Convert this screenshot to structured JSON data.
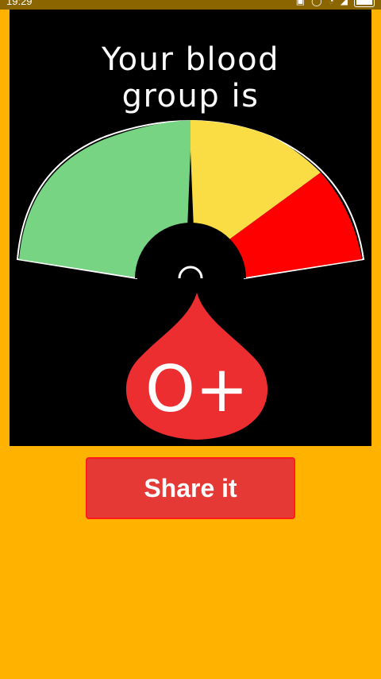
{
  "status_bar": {
    "time": "19:29",
    "icons": [
      "sim-icon",
      "alarm-icon",
      "wifi-icon",
      "signal-icon",
      "battery-icon"
    ]
  },
  "result": {
    "title_line1": "Your blood",
    "title_line2": "group is",
    "blood_group": "O+"
  },
  "colors": {
    "background": "#FFB300",
    "gauge_green": "#77D483",
    "gauge_yellow": "#FADD45",
    "gauge_red": "#FF0000",
    "drop_red": "#ED2E31"
  },
  "actions": {
    "share_label": "Share it"
  }
}
